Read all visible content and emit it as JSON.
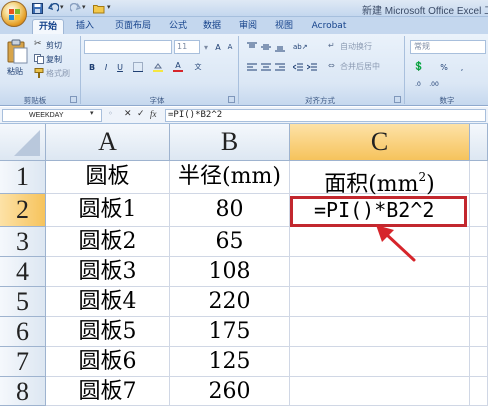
{
  "window": {
    "title": "新建 Microsoft Office Excel 工"
  },
  "tabs": [
    {
      "label": "开始",
      "active": true
    },
    {
      "label": "插入",
      "active": false
    },
    {
      "label": "页面布局",
      "active": false
    },
    {
      "label": "公式",
      "active": false
    },
    {
      "label": "数据",
      "active": false
    },
    {
      "label": "审阅",
      "active": false
    },
    {
      "label": "视图",
      "active": false
    },
    {
      "label": "Acrobat",
      "active": false
    }
  ],
  "ribbon": {
    "clipboard": {
      "paste_label": "粘贴",
      "cut_label": "剪切",
      "copy_label": "复制",
      "format_painter_label": "格式刷",
      "group_label": "剪贴板"
    },
    "font": {
      "font_size_value": "11",
      "group_label": "字体"
    },
    "alignment": {
      "wrap_text_label": "自动换行",
      "merge_center_label": "合并后居中",
      "group_label": "对齐方式"
    },
    "number": {
      "format_value": "常规",
      "group_label": "数字"
    }
  },
  "formula_bar": {
    "name_box": "WEEKDAY",
    "formula": "=PI()*B2^2"
  },
  "sheet": {
    "columns": [
      "A",
      "B",
      "C"
    ],
    "rows": [
      "1",
      "2",
      "3",
      "4",
      "5",
      "6",
      "7",
      "8"
    ],
    "header_row": {
      "A": "圆板",
      "B": "半径(mm)",
      "C_text": "面积(mm",
      "C_sup": "2",
      "C_close": ")"
    },
    "data": [
      {
        "name": "圆板1",
        "radius": "80",
        "area": "=PI()*B2^2"
      },
      {
        "name": "圆板2",
        "radius": "65",
        "area": ""
      },
      {
        "name": "圆板3",
        "radius": "108",
        "area": ""
      },
      {
        "name": "圆板4",
        "radius": "220",
        "area": ""
      },
      {
        "name": "圆板5",
        "radius": "175",
        "area": ""
      },
      {
        "name": "圆板6",
        "radius": "125",
        "area": ""
      },
      {
        "name": "圆板7",
        "radius": "260",
        "area": ""
      }
    ]
  },
  "colors": {
    "highlight_box": "#c2272e",
    "arrow": "#d6252b"
  }
}
